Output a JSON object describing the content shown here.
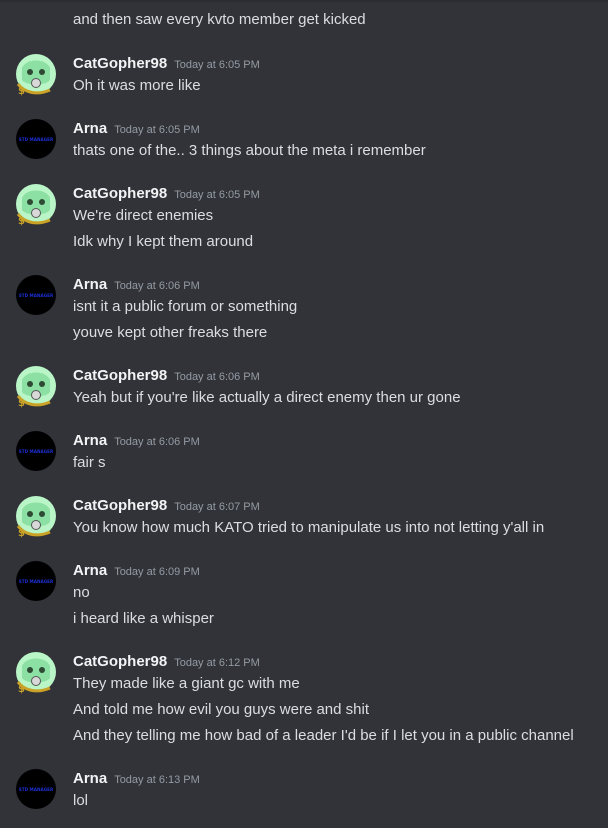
{
  "channel": {
    "messages": [
      {
        "continuation": true,
        "lines": [
          "and then saw every kvto member get kicked"
        ]
      },
      {
        "author": "CatGopher98",
        "avatar": "cat-gopher-avatar",
        "time": "Today at 6:05 PM",
        "lines": [
          "Oh it was more like"
        ]
      },
      {
        "author": "Arna",
        "avatar": "std-manager-avatar",
        "avatar_text": "STD MANAGER",
        "time": "Today at 6:05 PM",
        "lines": [
          "thats one of the.. 3 things about the meta i remember"
        ]
      },
      {
        "author": "CatGopher98",
        "avatar": "cat-gopher-avatar",
        "time": "Today at 6:05 PM",
        "lines": [
          "We're direct enemies",
          "Idk why I kept them around"
        ]
      },
      {
        "author": "Arna",
        "avatar": "std-manager-avatar",
        "avatar_text": "STD MANAGER",
        "time": "Today at 6:06 PM",
        "lines": [
          "isnt it a public forum or something",
          "youve kept other freaks there"
        ]
      },
      {
        "author": "CatGopher98",
        "avatar": "cat-gopher-avatar",
        "time": "Today at 6:06 PM",
        "lines": [
          "Yeah but if you're like actually a direct enemy then ur gone"
        ]
      },
      {
        "author": "Arna",
        "avatar": "std-manager-avatar",
        "avatar_text": "STD MANAGER",
        "time": "Today at 6:06 PM",
        "lines": [
          "fair s"
        ]
      },
      {
        "author": "CatGopher98",
        "avatar": "cat-gopher-avatar",
        "time": "Today at 6:07 PM",
        "lines": [
          "You know how much KATO tried to manipulate us into not letting y'all in"
        ]
      },
      {
        "author": "Arna",
        "avatar": "std-manager-avatar",
        "avatar_text": "STD MANAGER",
        "time": "Today at 6:09 PM",
        "lines": [
          "no",
          "i heard like a whisper"
        ]
      },
      {
        "author": "CatGopher98",
        "avatar": "cat-gopher-avatar",
        "time": "Today at 6:12 PM",
        "lines": [
          "They made like a giant gc with me",
          "And told me how evil you guys were and shit",
          "And they telling me how bad of a leader I'd be if I let you in a public channel"
        ]
      },
      {
        "author": "Arna",
        "avatar": "std-manager-avatar",
        "avatar_text": "STD MANAGER",
        "time": "Today at 6:13 PM",
        "lines": [
          "lol"
        ]
      }
    ]
  },
  "colors": {
    "background": "#313338",
    "text": "#dbdee1",
    "author": "#f2f3f5",
    "timestamp": "#949ba4",
    "cat_avatar_green": "#b9f5c6",
    "cat_avatar_gold": "#c9a227",
    "std_avatar_bg": "#000000",
    "std_avatar_text": "#1a2fd6"
  }
}
